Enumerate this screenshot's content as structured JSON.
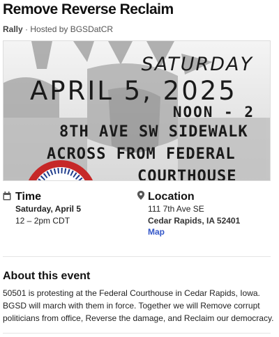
{
  "event": {
    "title": "Remove Reverse Reclaim",
    "type": "Rally",
    "separator": " · ",
    "host_line": "Hosted by BGSDatCR"
  },
  "banner": {
    "day": "SATURDAY",
    "date": "APRIL 5, 2025",
    "time": "NOON - 2",
    "location_lines": [
      "8TH AVE SW SIDEWALK",
      "ACROSS FROM FEDERAL",
      "COURTHOUSE"
    ]
  },
  "time_section": {
    "heading": "Time",
    "icon": "calendar-icon",
    "date": "Saturday, April 5",
    "hours": "12 – 2pm CDT"
  },
  "location_section": {
    "heading": "Location",
    "icon": "map-pin-icon",
    "street": "111 7th Ave SE",
    "city": "Cedar Rapids, IA 52401",
    "map_link": "Map"
  },
  "about": {
    "heading": "About this event",
    "body": "50501 is protesting at the Federal Courthouse in Cedar Rapids, Iowa. BGSD will march with them in force. Together we will Remove corrupt politicians from office, Reverse the damage, and Reclaim our democracy."
  },
  "colors": {
    "link": "#3356c8",
    "text": "#1c1c1c",
    "badge_red": "#c62828",
    "badge_blue": "#1f3c8c"
  }
}
